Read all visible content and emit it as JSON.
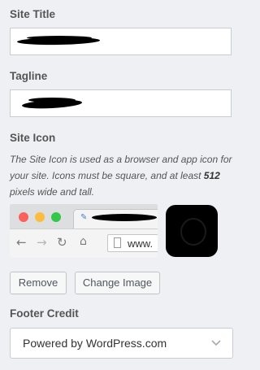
{
  "site_title": {
    "label": "Site Title",
    "value": ""
  },
  "tagline": {
    "label": "Tagline",
    "value": ""
  },
  "site_icon": {
    "label": "Site Icon",
    "description_before": "The Site Icon is used as a browser and app icon for your site. Icons must be square, and at least ",
    "description_bold": "512",
    "description_after": " pixels wide and tall.",
    "preview_url_text": "www.",
    "remove_label": "Remove",
    "change_label": "Change Image"
  },
  "footer_credit": {
    "label": "Footer Credit",
    "selected": "Powered by WordPress.com"
  },
  "colors": {
    "background": "#eef0f3",
    "dot_red": "#fc605c",
    "dot_yellow": "#fdbc40",
    "dot_green": "#34c84a"
  }
}
